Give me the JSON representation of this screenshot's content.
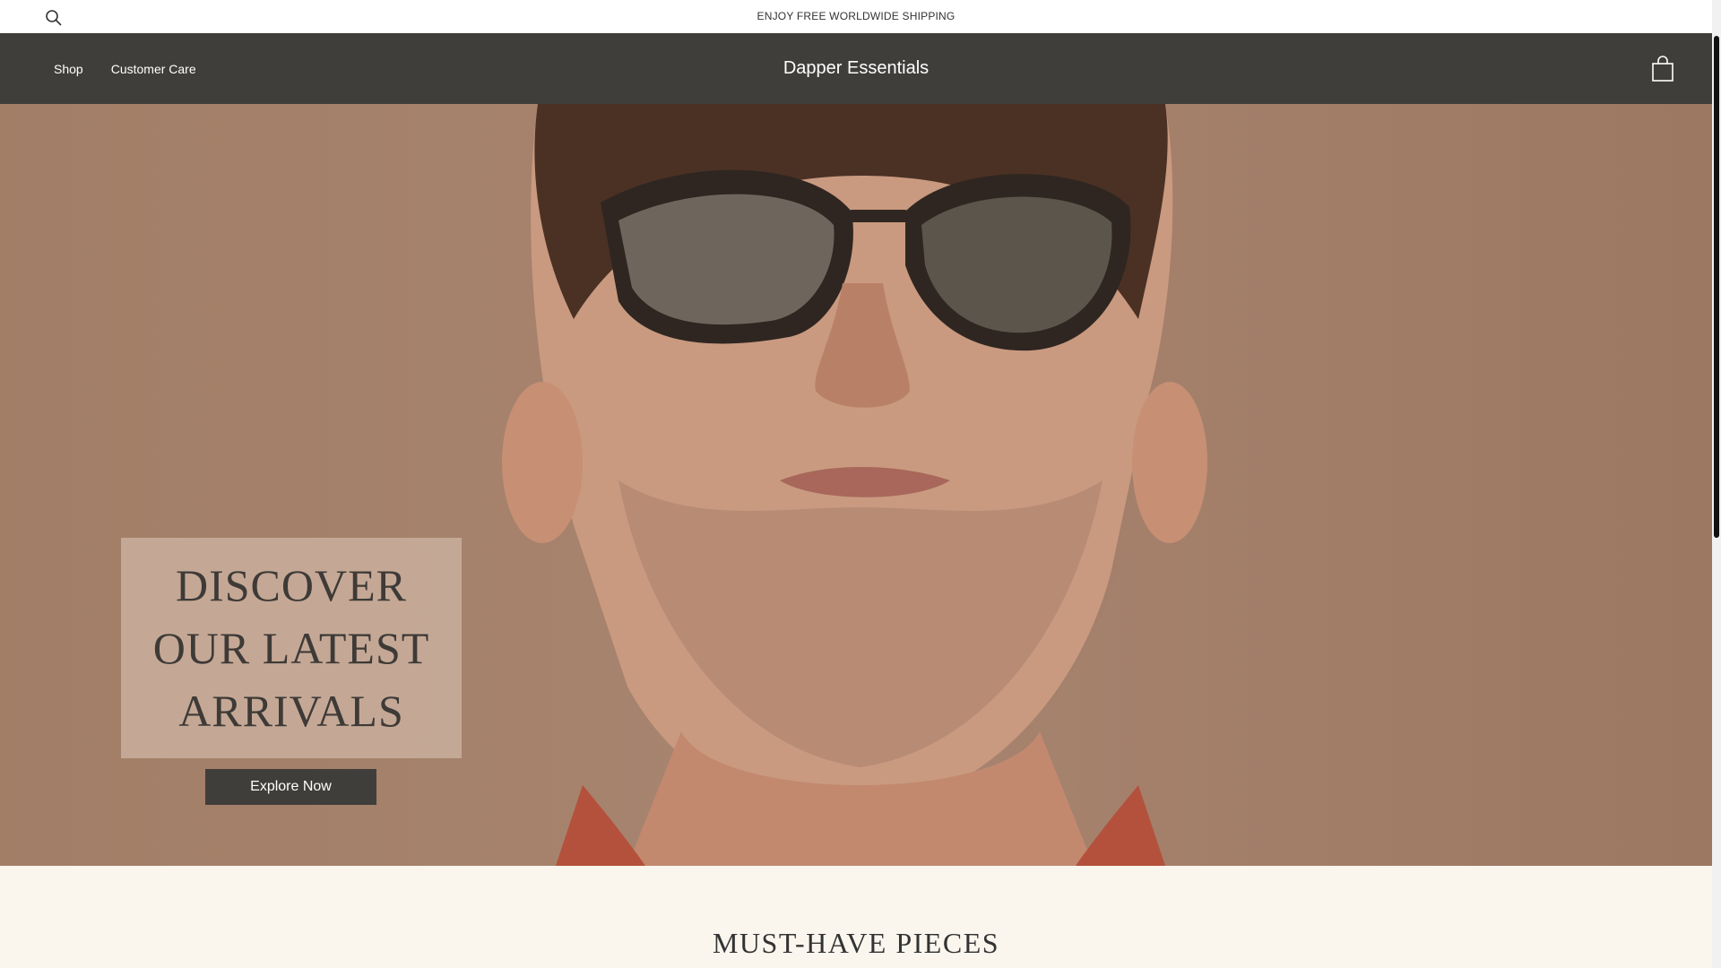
{
  "announcement": {
    "text": "ENJOY FREE WORLDWIDE SHIPPING",
    "search_icon": "search-icon"
  },
  "header": {
    "brand": "Dapper Essentials",
    "nav": [
      "Shop",
      "Customer Care"
    ],
    "cart_icon": "shopping-bag-icon"
  },
  "hero": {
    "heading": "DISCOVER\nOUR LATEST\nARRIVALS",
    "button_label": "Explore Now",
    "image": "man-wearing-sunglasses-photo"
  },
  "section": {
    "heading": "MUST-HAVE PIECES"
  },
  "colors": {
    "header_bg": "#403e3b",
    "hero_bg": "#a88570",
    "card_bg": "#cdb4a2",
    "section_bg": "#faf6ee"
  }
}
